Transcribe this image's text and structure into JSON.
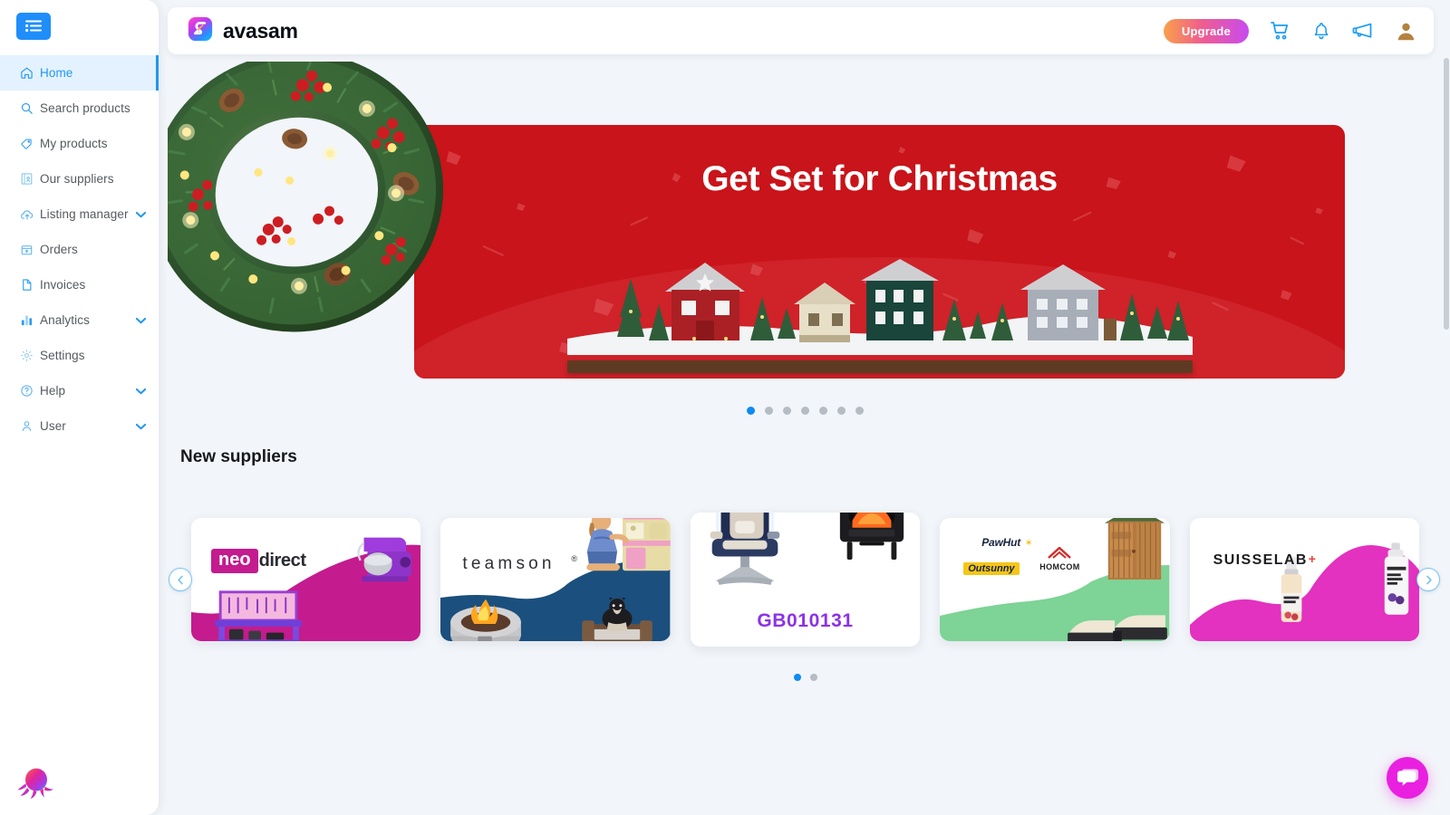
{
  "sidebar": {
    "menu_toggle": "menu-toggle",
    "items": [
      {
        "label": "Home",
        "icon": "home-icon",
        "active": true,
        "caret": false
      },
      {
        "label": "Search products",
        "icon": "search-icon",
        "active": false,
        "caret": false
      },
      {
        "label": "My products",
        "icon": "tag-icon",
        "active": false,
        "caret": false
      },
      {
        "label": "Our suppliers",
        "icon": "suppliers-icon",
        "active": false,
        "caret": false
      },
      {
        "label": "Listing manager",
        "icon": "cloud-up-icon",
        "active": false,
        "caret": true
      },
      {
        "label": "Orders",
        "icon": "box-icon",
        "active": false,
        "caret": false
      },
      {
        "label": "Invoices",
        "icon": "document-icon",
        "active": false,
        "caret": false
      },
      {
        "label": "Analytics",
        "icon": "bar-chart-icon",
        "active": false,
        "caret": true
      },
      {
        "label": "Settings",
        "icon": "gear-icon",
        "active": false,
        "caret": false
      },
      {
        "label": "Help",
        "icon": "question-icon",
        "active": false,
        "caret": true
      },
      {
        "label": "User",
        "icon": "person-icon",
        "active": false,
        "caret": true
      }
    ],
    "mascot": "octopus-mascot"
  },
  "topbar": {
    "brand": "avasam",
    "logo_icon": "avasam-logo",
    "upgrade_label": "Upgrade",
    "icons": [
      {
        "name": "cart-icon"
      },
      {
        "name": "bell-icon"
      },
      {
        "name": "megaphone-icon"
      },
      {
        "name": "user-avatar"
      }
    ]
  },
  "banner": {
    "title": "Get Set for Christmas",
    "background_color": "#c8141a",
    "total_slides": 7,
    "active_slide": 1
  },
  "suppliers": {
    "section_title": "New suppliers",
    "prev_label": "‹",
    "next_label": "›",
    "total_pages": 2,
    "active_page": 1,
    "cards": [
      {
        "name": "neo direct",
        "logo_text": "neo",
        "logo_text2": "direct",
        "accent": "#c41b8f",
        "raised": false
      },
      {
        "name": "teamson",
        "logo_text": "teamson",
        "logo_text2": "",
        "accent": "#1b4f7e",
        "raised": false
      },
      {
        "name": "GB010131",
        "logo_text": "GB010131",
        "logo_text2": "",
        "accent": "#8b32e8",
        "raised": true
      },
      {
        "name": "PawHut HOMCOM Outsunny",
        "logo_text": "PawHut",
        "logo_text2": "Outsunny",
        "logo_text3": "HOMCOM",
        "accent": "#7ed396",
        "raised": false
      },
      {
        "name": "SUISSELAB",
        "logo_text": "SUISSELAB",
        "logo_text2": "+",
        "accent": "#e331c0",
        "raised": false
      }
    ]
  },
  "chat": {
    "icon": "chat-bubble-icon",
    "color": "#e920e0"
  }
}
